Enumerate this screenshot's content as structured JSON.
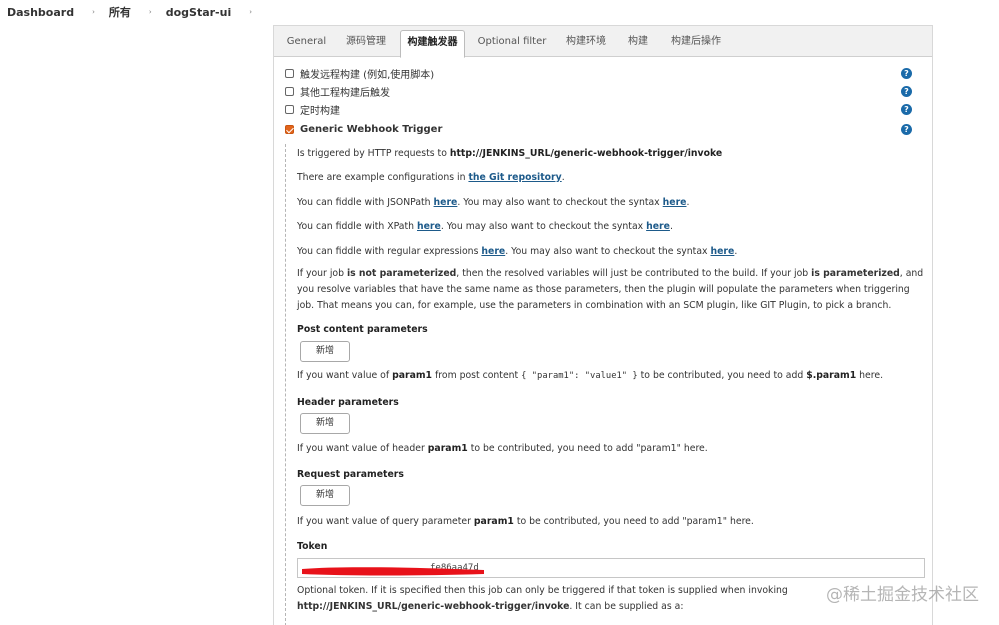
{
  "breadcrumb": [
    "Dashboard",
    "所有",
    "dogStar-ui"
  ],
  "tabs": [
    "General",
    "源码管理",
    "构建触发器",
    "Optional filter",
    "构建环境",
    "构建",
    "构建后操作"
  ],
  "active_tab": "构建触发器",
  "triggers": [
    {
      "label": "触发远程构建 (例如,使用脚本)",
      "checked": false
    },
    {
      "label": "其他工程构建后触发",
      "checked": false
    },
    {
      "label": "定时构建",
      "checked": false
    },
    {
      "label": "Generic Webhook Trigger",
      "checked": true
    }
  ],
  "help_glyph": "?",
  "webhook": {
    "triggered_pre": "Is triggered by HTTP requests to ",
    "triggered_url": "http://JENKINS_URL/generic-webhook-trigger/invoke",
    "examples_pre": "There are example configurations in ",
    "examples_link": "the Git repository",
    "examples_post": ".",
    "fiddle_prefix": "You can fiddle with ",
    "fiddle_middle": ". You may also want to checkout the syntax ",
    "here": "here",
    "dot": ".",
    "fiddles": [
      "JSONPath",
      "XPath",
      "regular expressions"
    ],
    "param_text": {
      "a": "If your job ",
      "b": "is not parameterized",
      "c": ", then the resolved variables will just be contributed to the build. If your job ",
      "d": "is parameterized",
      "e": ", and you resolve variables that have the same name as those parameters, then the plugin will populate the parameters when triggering job. That means you can, for example, use the parameters in combination with an SCM plugin, like GIT Plugin, to pick a branch."
    },
    "post_content": {
      "heading": "Post content parameters",
      "button": "新增",
      "t1": "If you want value of ",
      "param": "param1",
      "t2": " from post content ",
      "code": "{ \"param1\": \"value1\" }",
      "t3": " to be contributed, you need to add ",
      "path": "$.param1",
      "t4": " here."
    },
    "header": {
      "heading": "Header parameters",
      "button": "新增",
      "t1": "If you want value of header ",
      "param": "param1",
      "t2": " to be contributed, you need to add \"param1\" here."
    },
    "request": {
      "heading": "Request parameters",
      "button": "新增",
      "t1": "If you want value of query parameter ",
      "param": "param1",
      "t2": " to be contributed, you need to add \"param1\" here."
    },
    "token": {
      "heading": "Token",
      "value": "fe86aa47d",
      "t1": "Optional token. If it is specified then this job can only be triggered if that token is supplied when invoking ",
      "url": "http://JENKINS_URL/generic-webhook-trigger/invoke",
      "t2": ". It can be supplied as a:"
    }
  },
  "watermark": "@稀土掘金技术社区",
  "colors": {
    "checkbox_checked": "#e2651c",
    "help_icon": "#1a6aa9",
    "link": "#1d5a8a",
    "redaction": "#e8121a"
  }
}
